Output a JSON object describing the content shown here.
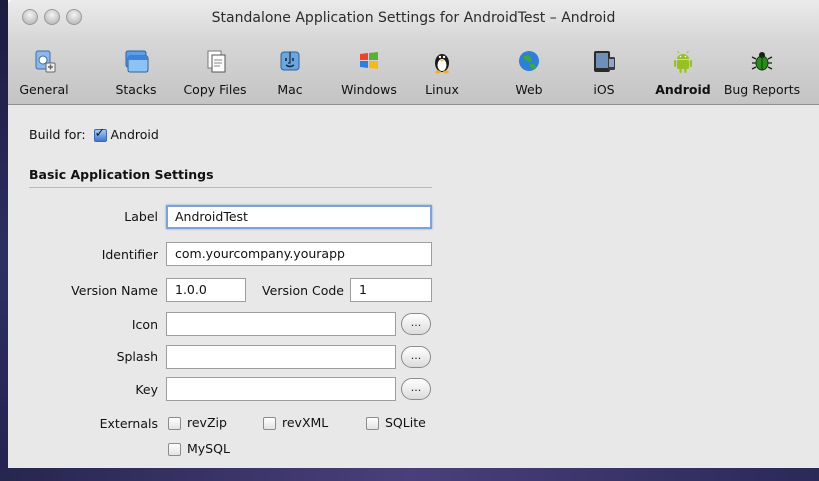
{
  "window": {
    "title": "Standalone Application Settings for AndroidTest – Android"
  },
  "toolbar": {
    "items": [
      {
        "label": "General",
        "icon": "general-icon"
      },
      {
        "label": "Stacks",
        "icon": "stacks-icon"
      },
      {
        "label": "Copy Files",
        "icon": "copy-files-icon"
      },
      {
        "label": "Mac",
        "icon": "mac-icon"
      },
      {
        "label": "Windows",
        "icon": "windows-icon"
      },
      {
        "label": "Linux",
        "icon": "linux-icon"
      },
      {
        "label": "Web",
        "icon": "web-icon"
      },
      {
        "label": "iOS",
        "icon": "ios-icon"
      },
      {
        "label": "Android",
        "icon": "android-icon",
        "selected": true
      },
      {
        "label": "Bug Reports",
        "icon": "bug-reports-icon"
      }
    ]
  },
  "build_for": {
    "label": "Build for:",
    "platform": "Android",
    "checked": true
  },
  "basic": {
    "title": "Basic Application Settings",
    "label_label": "Label",
    "label_value": "AndroidTest",
    "identifier_label": "Identifier",
    "identifier_value": "com.yourcompany.yourapp",
    "version_name_label": "Version Name",
    "version_name_value": "1.0.0",
    "version_code_label": "Version Code",
    "version_code_value": "1",
    "icon_label": "Icon",
    "icon_value": "",
    "splash_label": "Splash",
    "splash_value": "",
    "key_label": "Key",
    "key_value": "",
    "browse_label": "...",
    "externals_label": "Externals",
    "externals": [
      {
        "label": "revZip",
        "checked": false
      },
      {
        "label": "revXML",
        "checked": false
      },
      {
        "label": "SQLite",
        "checked": false
      },
      {
        "label": "MySQL",
        "checked": false
      }
    ]
  },
  "colors": {
    "accent": "#3f78c9",
    "focus_ring": "#7ea1d8",
    "window_bg": "#e8e8e8"
  }
}
